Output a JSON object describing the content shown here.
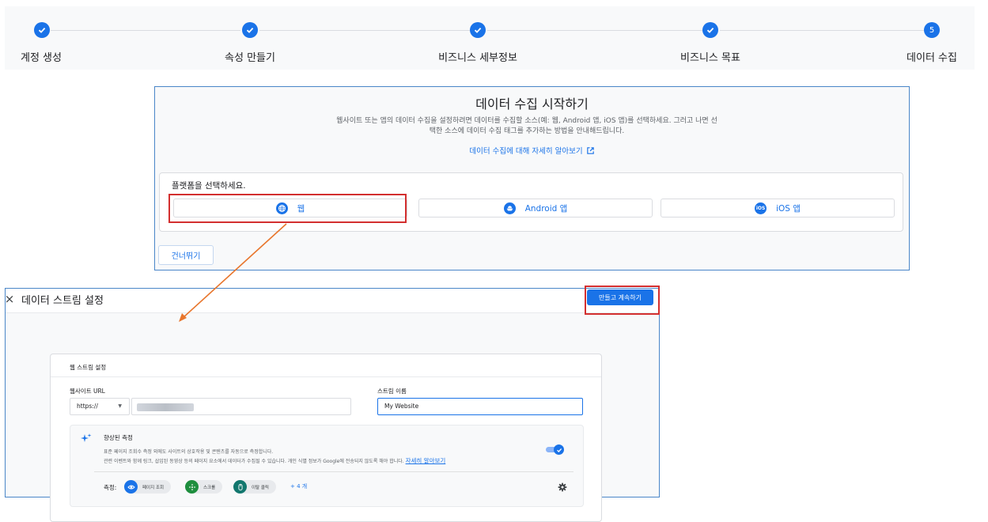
{
  "stepper": {
    "steps": [
      {
        "label": "계정 생성",
        "state": "done"
      },
      {
        "label": "속성 만들기",
        "state": "done"
      },
      {
        "label": "비즈니스 세부정보",
        "state": "done"
      },
      {
        "label": "비즈니스 목표",
        "state": "done"
      },
      {
        "label": "데이터 수집",
        "state": "current",
        "number": "5"
      }
    ]
  },
  "collection": {
    "title": "데이터 수집 시작하기",
    "description_line1": "웹사이트 또는 앱의 데이터 수집을 설정하려면 데이터를 수집할 소스(예: 웹, Android 앱, iOS 앱)를 선택하세요. 그러고 나면 선",
    "description_line2": "택한 소스에 데이터 수집 태그를 추가하는 방법을 안내해드립니다.",
    "learn_more_link": "데이터 수집에 대해 자세히 알아보기",
    "platform_title": "플랫폼을 선택하세요.",
    "platforms": [
      {
        "label": "웹",
        "icon": "globe-icon"
      },
      {
        "label": "Android 앱",
        "icon": "android-icon"
      },
      {
        "label": "iOS 앱",
        "icon": "ios-icon",
        "icon_text": "iOS"
      }
    ],
    "skip_label": "건너뛰기"
  },
  "stream_setup": {
    "title": "데이터 스트림 설정",
    "close_glyph": "×",
    "create_button": "만들고 계속하기",
    "card_title": "웹 스트림 설정",
    "url_label": "웹사이트 URL",
    "protocol_value": "https://",
    "url_value": "",
    "stream_name_label": "스트림 이름",
    "stream_name_value": "My Website",
    "enhanced": {
      "title": "향상된 측정",
      "desc_line1": "표준 페이지 조회수 측정 외에도 사이트의 상호작용 및 콘텐츠를 자동으로 측정합니다.",
      "desc_line2": "관련 이벤트와 함께 링크, 삽입된 동영상 등의 페이지 요소에서 데이터가 수집될 수 있습니다. 개인 식별 정보가 Google에 전송되지 않도록 해야 합니다.",
      "learn_more": "자세히 알아보기",
      "toggle_on": true,
      "measure_label": "측정:",
      "chips": [
        {
          "label": "페이지 조회",
          "icon": "eye-icon",
          "color": "#1a73e8"
        },
        {
          "label": "스크롤",
          "icon": "crosshair-icon",
          "color": "#1e8e3e"
        },
        {
          "label": "이탈 클릭",
          "icon": "mouse-icon",
          "color": "#12776e"
        }
      ],
      "more_label": "+ 4 개"
    }
  },
  "colors": {
    "accent": "#1a73e8",
    "highlight": "#d32f2f",
    "connector": "#e8762d"
  }
}
